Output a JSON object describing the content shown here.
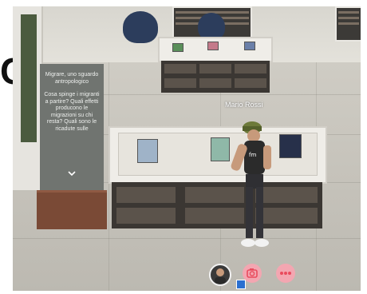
{
  "info_panel": {
    "title": "Migrare, uno sguardo antropologico",
    "body": "Cosa spinge i migranti a partire? Quali effetti producono le migrazioni su chi resta? Quali sono le ricadute sulle",
    "chevron_icon": "chevron-down-icon"
  },
  "avatar": {
    "name": "Mario Rossi"
  },
  "toolbar": {
    "buttons": [
      {
        "icon": "user-avatar-icon"
      },
      {
        "icon": "camera-icon"
      },
      {
        "icon": "more-options-icon"
      }
    ],
    "accent": "#e94b5d"
  },
  "overlay_text": "C."
}
